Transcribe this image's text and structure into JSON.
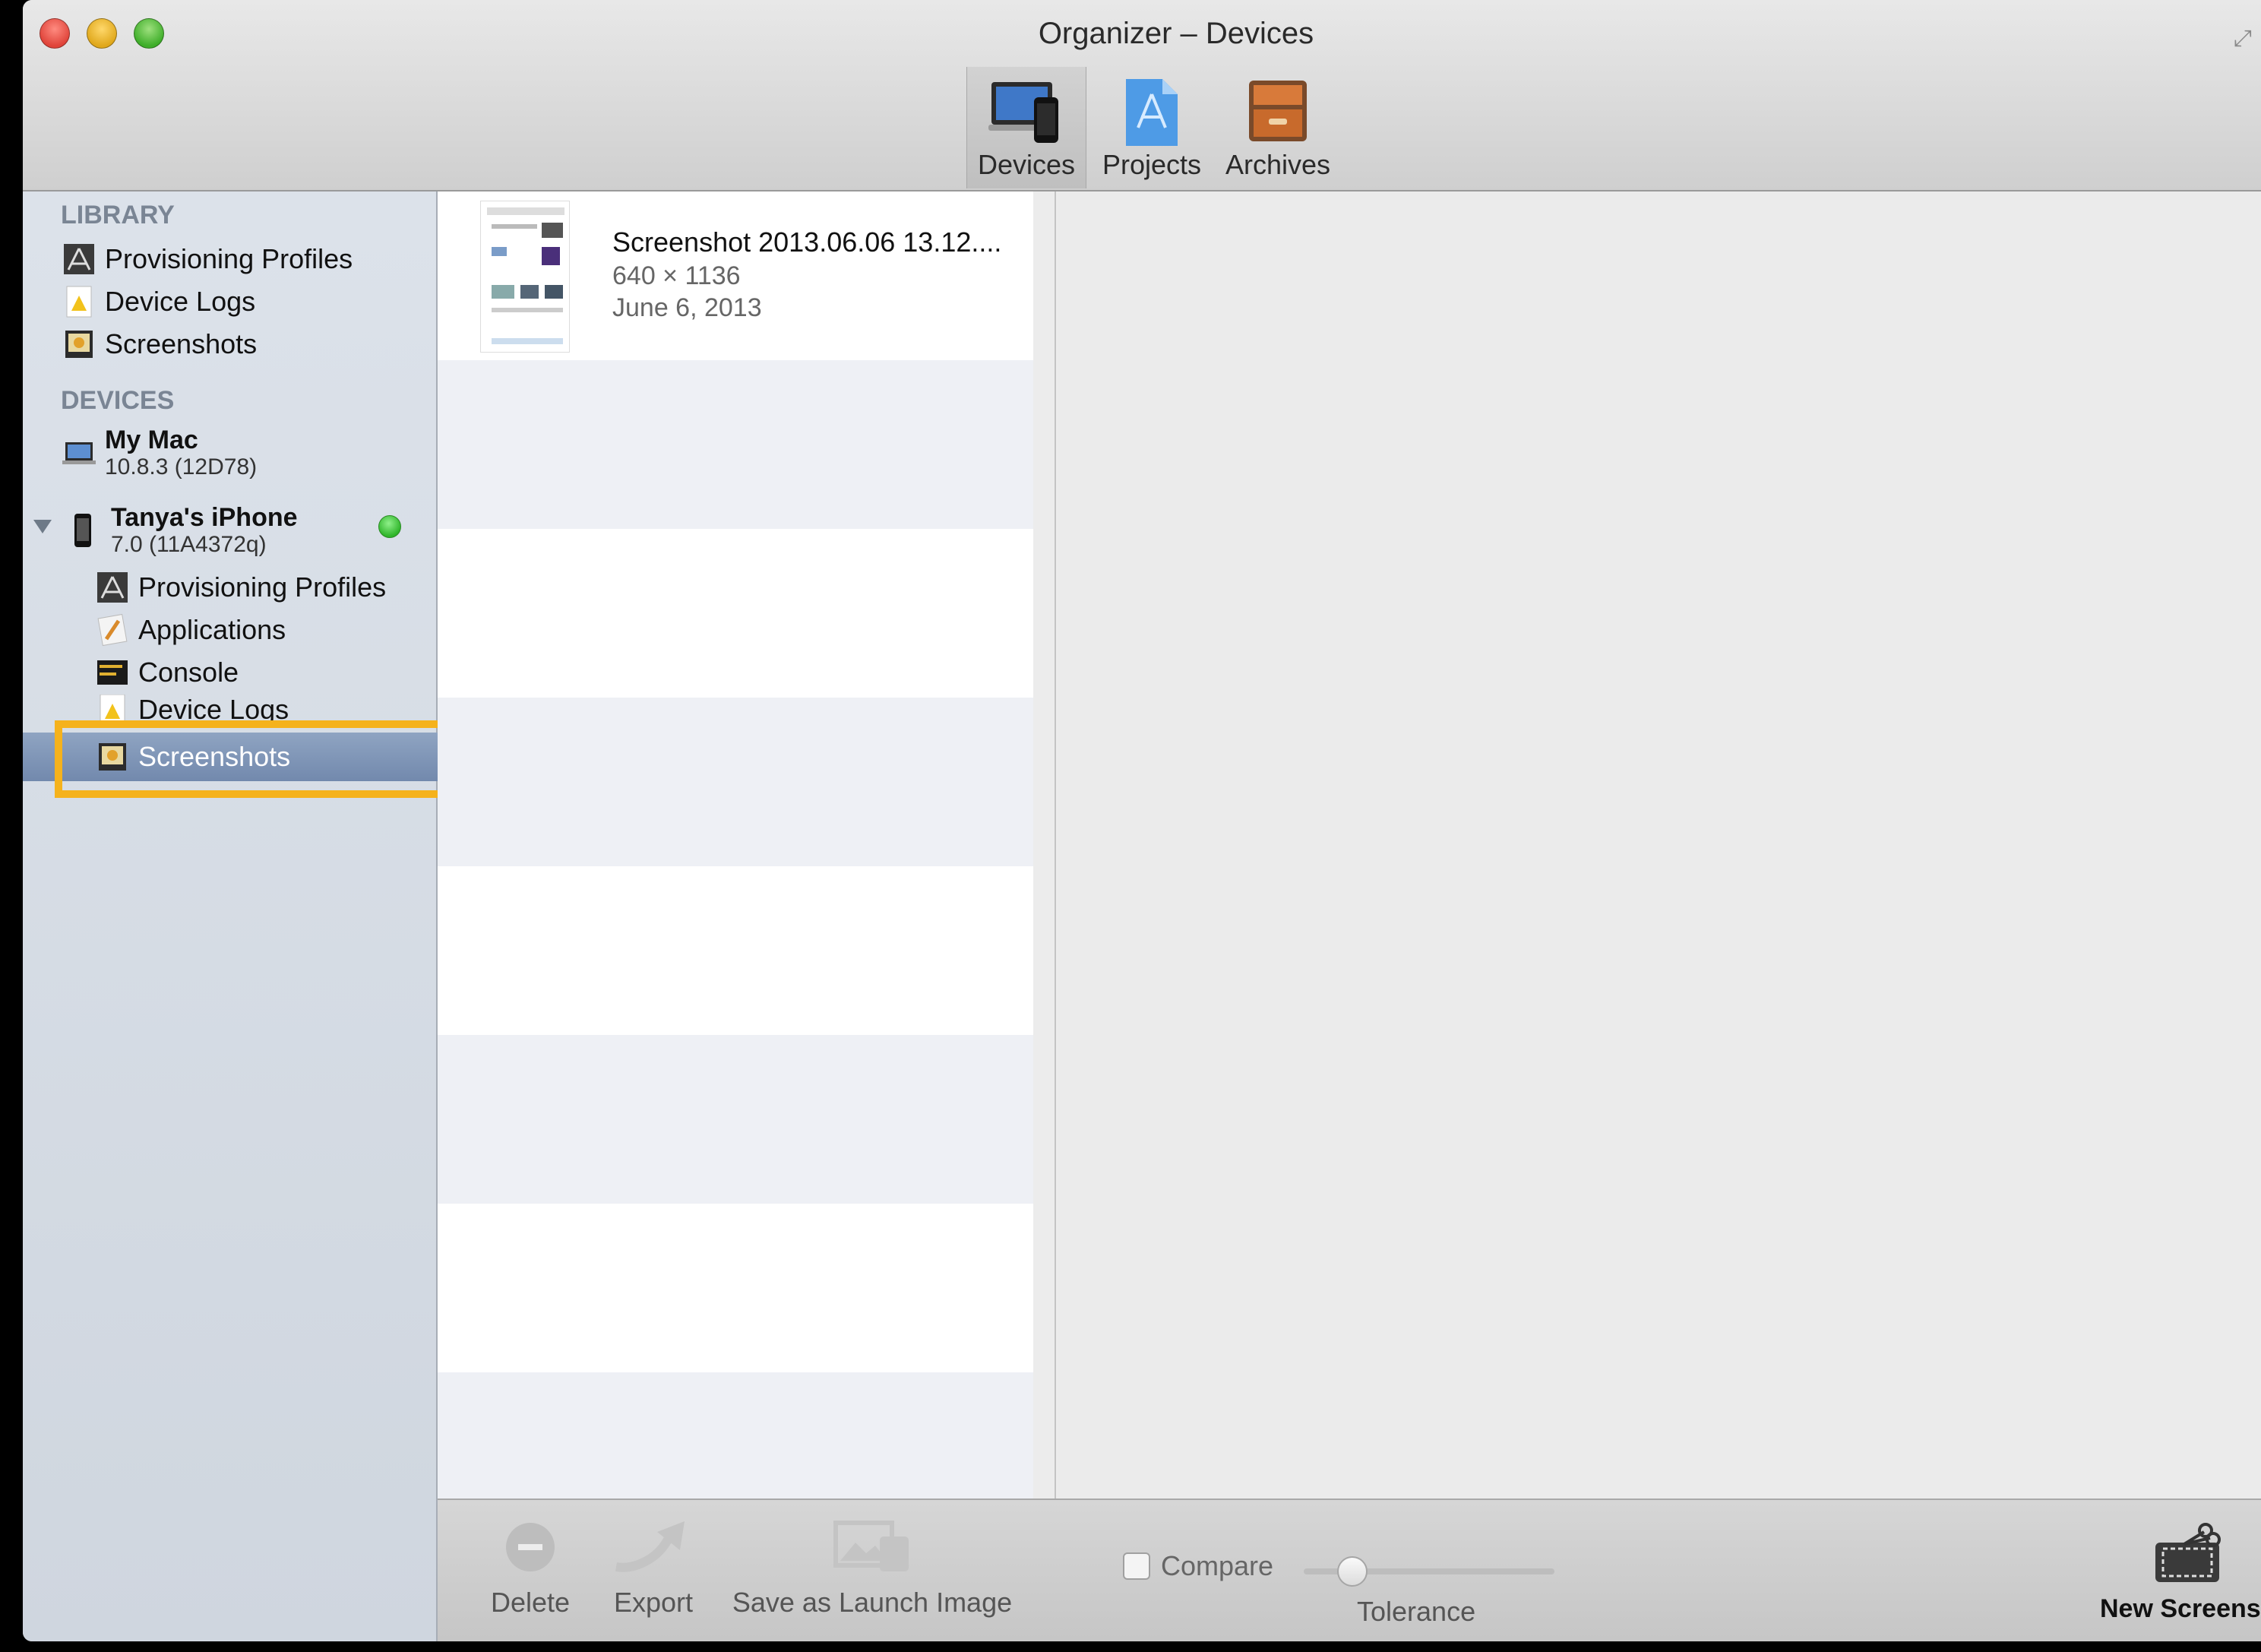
{
  "window": {
    "title": "Organizer – Devices"
  },
  "toolbar": {
    "tabs": [
      {
        "label": "Devices",
        "icon": "devices-icon"
      },
      {
        "label": "Projects",
        "icon": "projects-icon"
      },
      {
        "label": "Archives",
        "icon": "archives-icon"
      }
    ],
    "selected_tab": "Devices"
  },
  "sidebar": {
    "library_header": "LIBRARY",
    "library_items": [
      {
        "label": "Provisioning Profiles",
        "icon": "provisioning-profile-icon"
      },
      {
        "label": "Device Logs",
        "icon": "warning-log-icon"
      },
      {
        "label": "Screenshots",
        "icon": "screenshot-icon"
      }
    ],
    "devices_header": "DEVICES",
    "devices": [
      {
        "name": "My Mac",
        "version": "10.8.3 (12D78)",
        "icon": "mac-laptop-icon"
      },
      {
        "name": "Tanya's iPhone",
        "version": "7.0 (11A4372q)",
        "icon": "iphone-icon",
        "status": "connected",
        "children": [
          {
            "label": "Provisioning Profiles",
            "icon": "provisioning-profile-icon"
          },
          {
            "label": "Applications",
            "icon": "applications-icon"
          },
          {
            "label": "Console",
            "icon": "console-icon"
          },
          {
            "label": "Device Logs",
            "icon": "warning-log-icon"
          },
          {
            "label": "Screenshots",
            "icon": "screenshot-icon",
            "selected": true
          }
        ]
      }
    ]
  },
  "screenshots": [
    {
      "title": "Screenshot 2013.06.06 13.12....",
      "dimensions": "640 × 1136",
      "date": "June 6, 2013"
    }
  ],
  "bottombar": {
    "delete_label": "Delete",
    "export_label": "Export",
    "launch_label": "Save as Launch Image",
    "compare_label": "Compare",
    "tolerance_label": "Tolerance",
    "new_screenshot_label": "New Screenshot",
    "compare_checked": false
  },
  "colors": {
    "highlight": "#f5b21c",
    "selection": "#7f95b7",
    "status_green": "#2fb52a"
  }
}
